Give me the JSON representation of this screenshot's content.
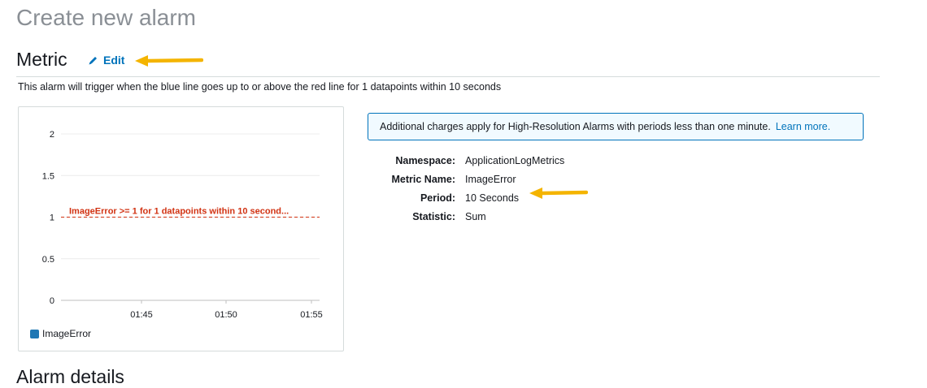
{
  "page": {
    "title": "Create new alarm"
  },
  "metric_section": {
    "title": "Metric",
    "edit_label": "Edit",
    "description": "This alarm will trigger when the blue line goes up to or above the red line for 1 datapoints within 10 seconds"
  },
  "chart_data": {
    "type": "line",
    "ylim": [
      0,
      2
    ],
    "y_ticks": [
      "0",
      "0.5",
      "1",
      "1.5",
      "2"
    ],
    "x_ticks": [
      "01:45",
      "01:50",
      "01:55"
    ],
    "grid": true,
    "series": [
      {
        "name": "ImageError",
        "values": [],
        "color": "#1f77b4"
      }
    ],
    "threshold": {
      "value": 1,
      "label": "ImageError >= 1 for 1 datapoints within 10 second...",
      "color": "#d13212"
    },
    "legend": {
      "placement": "bottom-left",
      "entries": [
        "ImageError"
      ]
    }
  },
  "info_banner": {
    "text": "Additional charges apply for High-Resolution Alarms with periods less than one minute.",
    "link": "Learn more."
  },
  "details": [
    {
      "key": "Namespace:",
      "value": "ApplicationLogMetrics"
    },
    {
      "key": "Metric Name:",
      "value": "ImageError"
    },
    {
      "key": "Period:",
      "value": "10 Seconds"
    },
    {
      "key": "Statistic:",
      "value": "Sum"
    }
  ],
  "next_section": {
    "title": "Alarm details"
  },
  "colors": {
    "accent": "#0073bb",
    "arrow": "#f4b400",
    "threshold": "#d13212",
    "series": "#1f77b4"
  },
  "icons": {
    "edit": "pencil-icon",
    "arrow": "arrow-left-icon"
  }
}
